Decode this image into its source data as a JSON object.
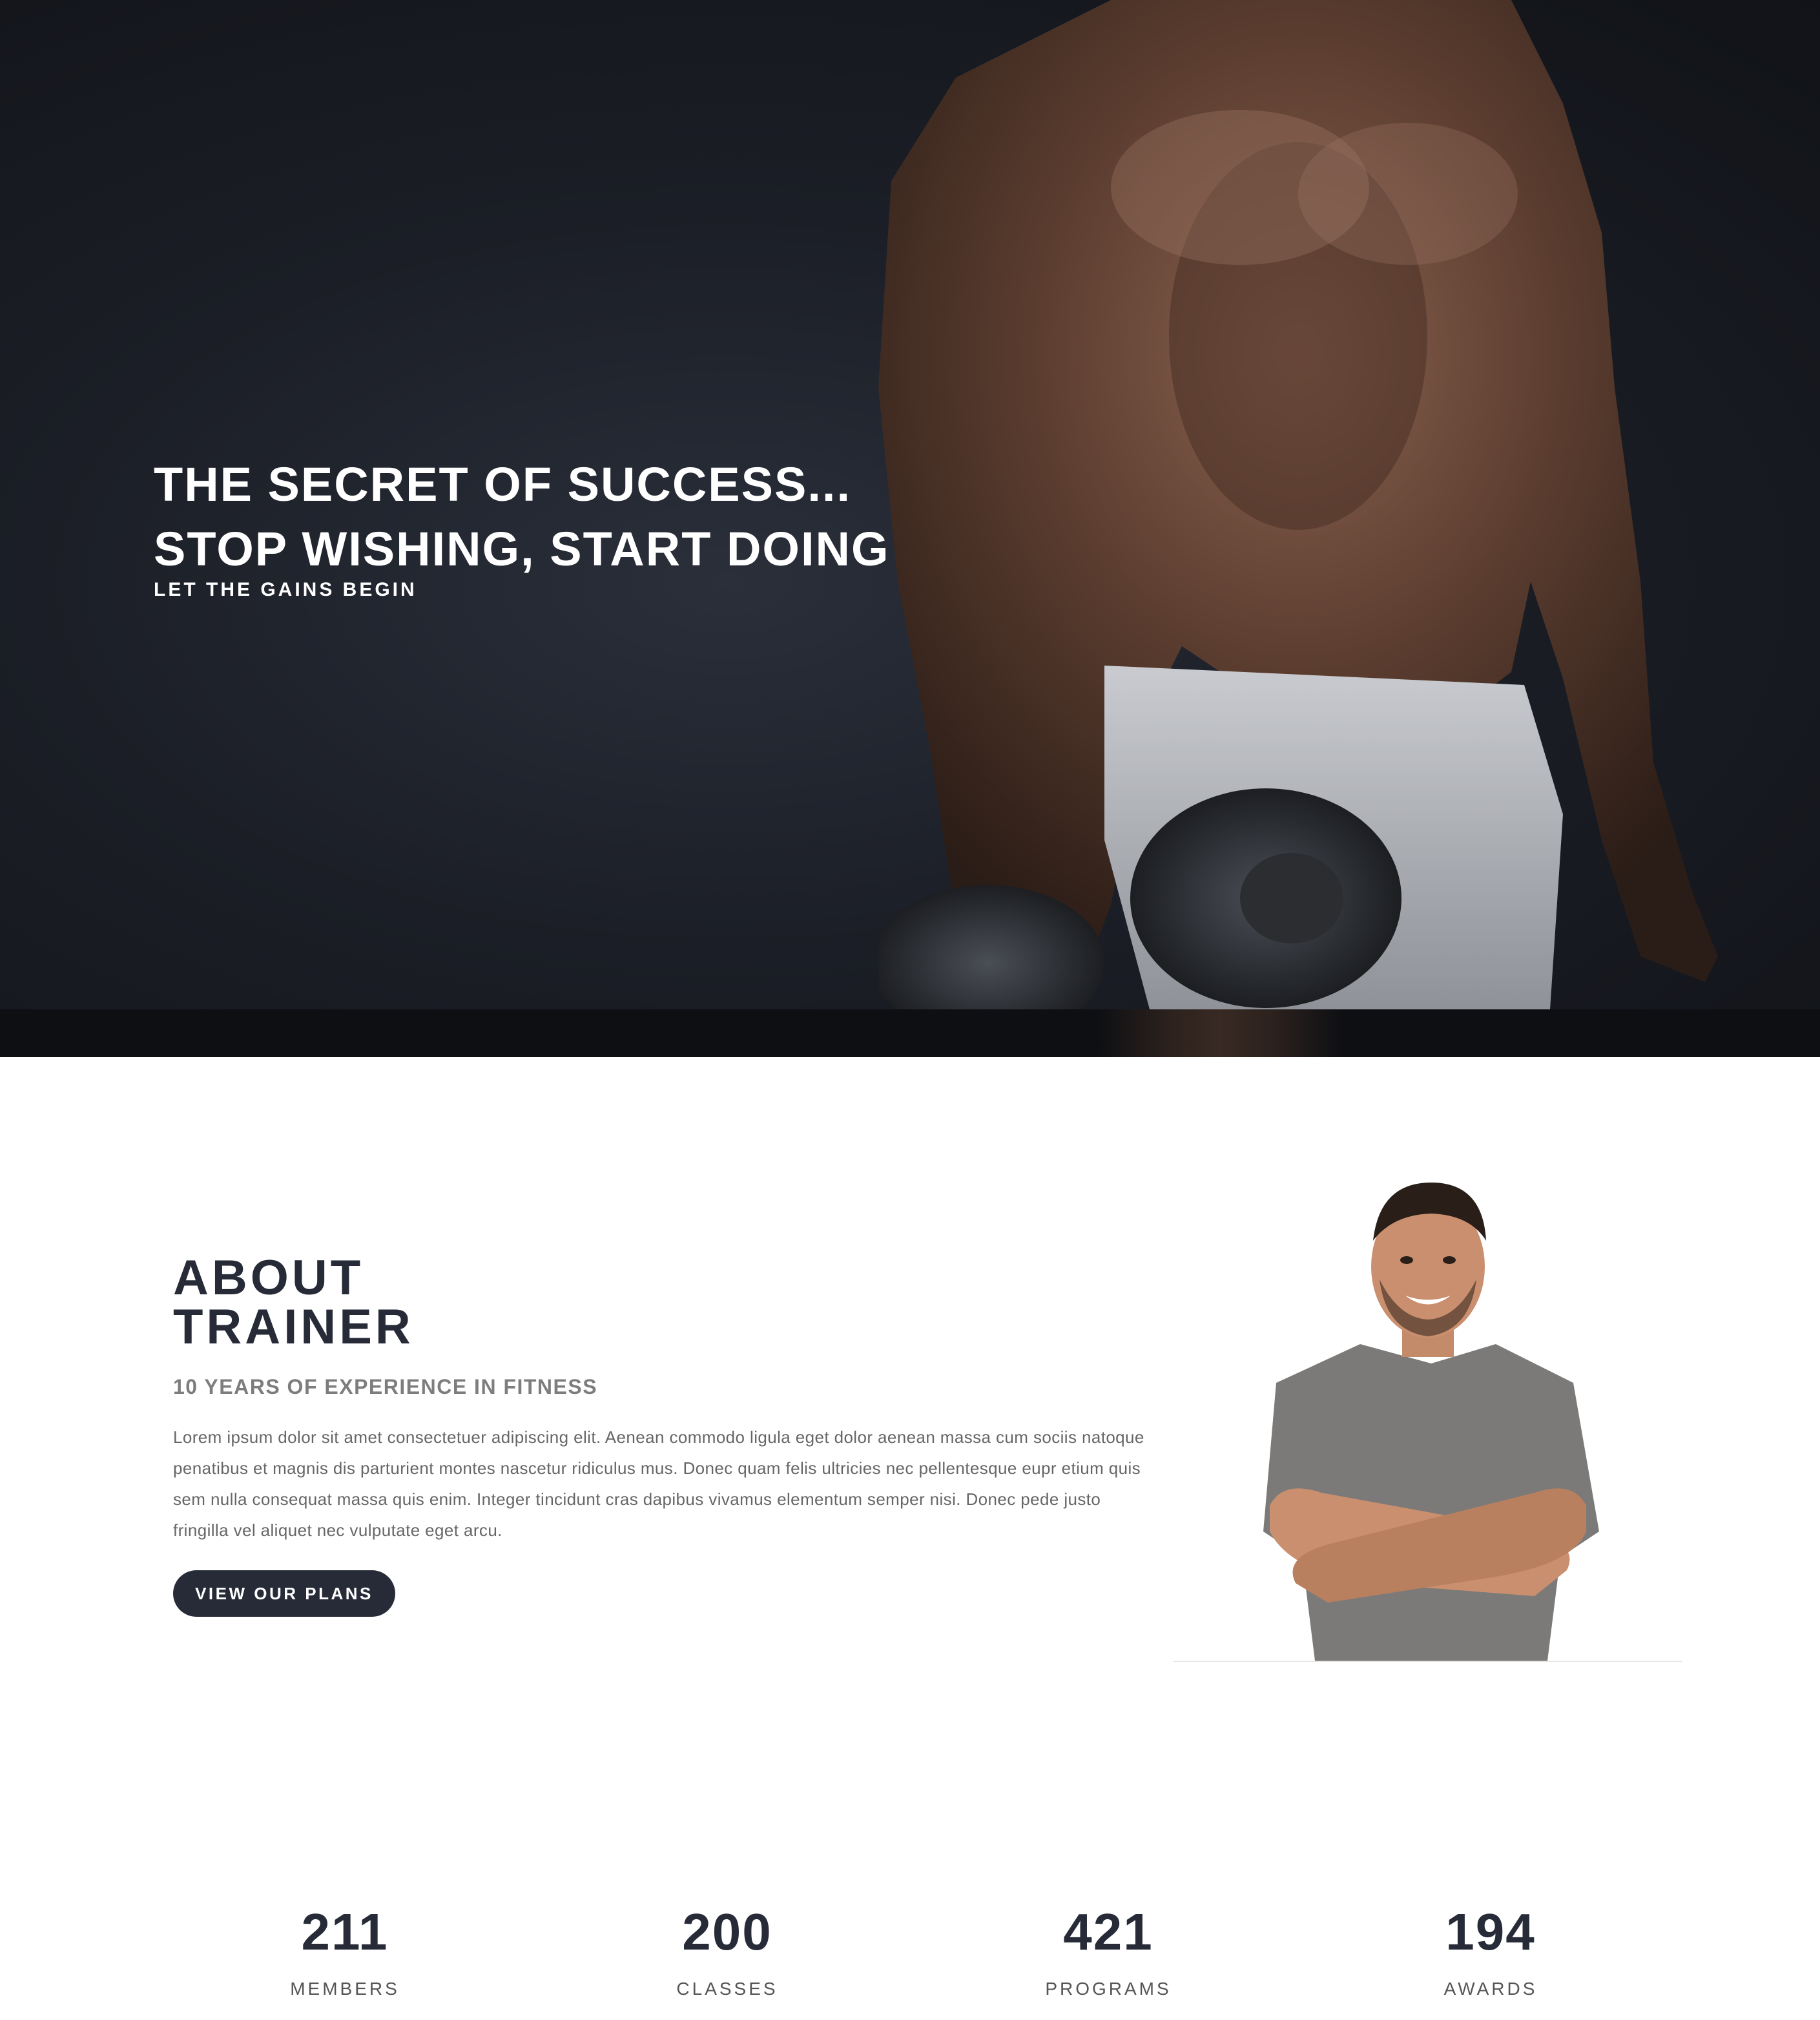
{
  "hero": {
    "line1": "THE SECRET OF SUCCESS...",
    "line2": "STOP WISHING, START DOING",
    "subtitle": "LET THE GAINS BEGIN"
  },
  "about": {
    "title_line1": "ABOUT",
    "title_line2": "TRAINER",
    "subtitle": "10 YEARS OF EXPERIENCE IN FITNESS",
    "body": "Lorem ipsum dolor sit amet consectetuer adipiscing elit. Aenean commodo ligula eget dolor aenean massa cum sociis natoque penatibus et magnis dis parturient montes nascetur ridiculus mus. Donec quam felis ultricies nec pellentesque eupr etium quis sem nulla consequat massa quis enim. Integer tincidunt cras dapibus vivamus elementum semper nisi. Donec pede justo fringilla vel aliquet nec vulputate eget arcu.",
    "button_label": "VIEW OUR PLANS"
  },
  "stats": [
    {
      "value": "211",
      "label": "MEMBERS"
    },
    {
      "value": "200",
      "label": "CLASSES"
    },
    {
      "value": "421",
      "label": "PROGRAMS"
    },
    {
      "value": "194",
      "label": "AWARDS"
    }
  ],
  "colors": {
    "dark_navy": "#272b38",
    "hero_bg": "#1b1e26",
    "muted_text": "#7d7d7d"
  }
}
